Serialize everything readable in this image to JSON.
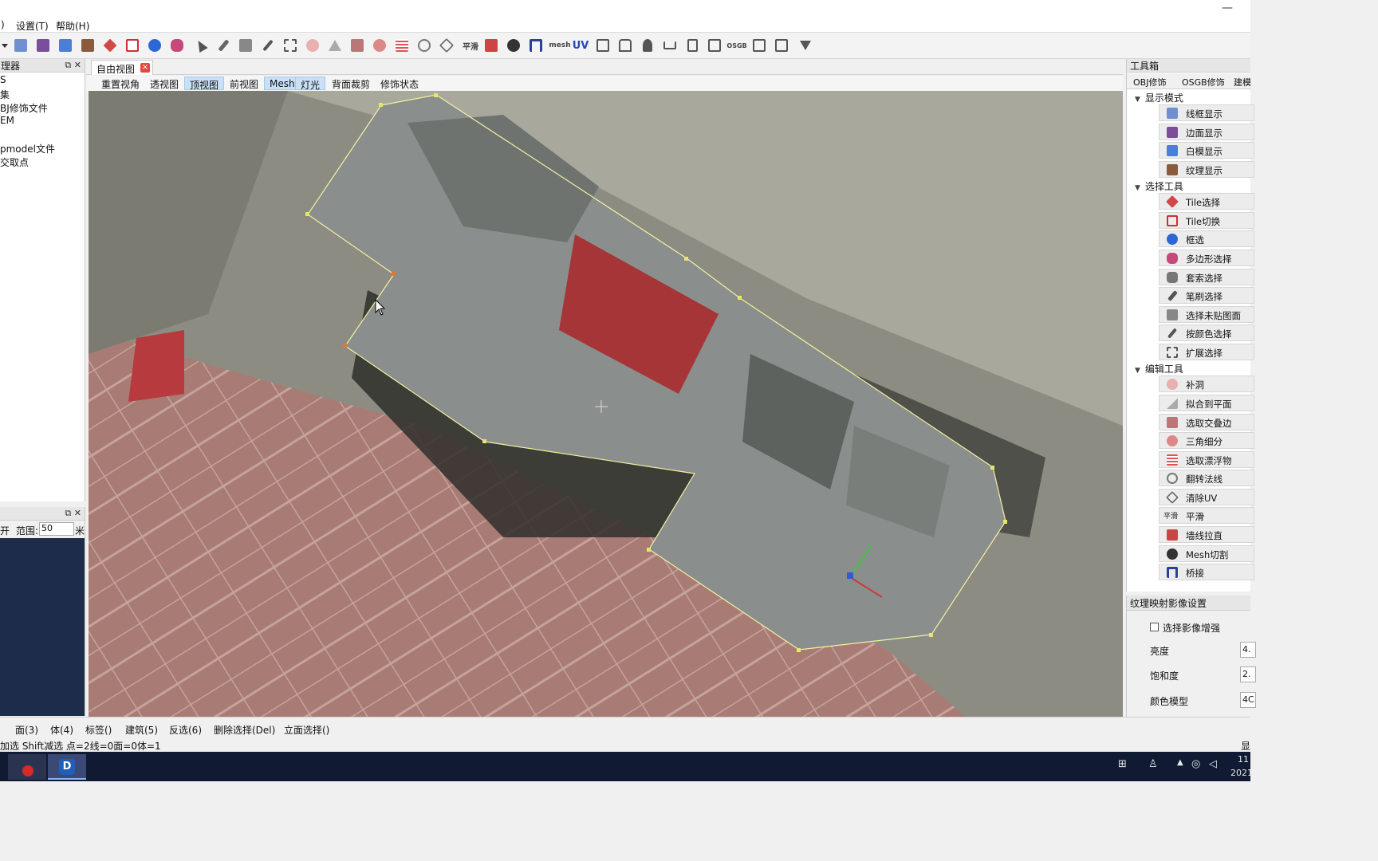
{
  "menu": {
    "item_close_paren": ")",
    "settings": "设置(T)",
    "help": "帮助(H)"
  },
  "toolbar": {
    "smooth_label": "平滑",
    "mesh_label": "mesh",
    "uv_label": "UV",
    "osgb_label": "OSGB"
  },
  "left_panel": {
    "title": "理器",
    "tree": [
      "S",
      "集",
      "BJ修饰文件",
      "EM",
      "",
      "pmodel文件",
      "交取点"
    ]
  },
  "left_panel2": {
    "open_label": "开",
    "range_label": "范围:",
    "range_value": "50",
    "unit": "米"
  },
  "view": {
    "tab_title": "自由视图",
    "buttons": [
      "重置视角",
      "透视图",
      "顶视图",
      "前视图",
      "Mesh",
      "灯光",
      "背面裁剪",
      "修饰状态"
    ],
    "active": [
      "顶视图",
      "Mesh",
      "灯光"
    ]
  },
  "toolbox": {
    "title": "工具箱",
    "tabs": [
      "OBJ修饰",
      "OSGB修饰",
      "建模"
    ],
    "sections": [
      {
        "name": "显示模式",
        "items": [
          "线框显示",
          "边面显示",
          "白模显示",
          "纹理显示"
        ]
      },
      {
        "name": "选择工具",
        "items": [
          "Tile选择",
          "Tile切换",
          "框选",
          "多边形选择",
          "套索选择",
          "笔刷选择",
          "选择未贴图面",
          "按颜色选择",
          "扩展选择"
        ]
      },
      {
        "name": "编辑工具",
        "items": [
          "补洞",
          "拟合到平面",
          "选取交叠边",
          "三角细分",
          "选取漂浮物",
          "翻转法线",
          "清除UV",
          "平滑",
          "墙线拉直",
          "Mesh切割",
          "桥接"
        ]
      }
    ]
  },
  "texture_settings": {
    "title": "纹理映射影像设置",
    "enhance_label": "选择影像增强",
    "brightness_label": "亮度",
    "brightness_value": "4.",
    "saturation_label": "饱和度",
    "saturation_value": "2.",
    "color_model_label": "颜色模型",
    "color_model_value": "4C"
  },
  "bottom": {
    "buttons": [
      "面(3)",
      "体(4)",
      "标签()",
      "建筑(5)",
      "反选(6)",
      "删除选择(Del)",
      "立面选择()"
    ],
    "status": "加选 Shift减选 点=2线=0面=0体=1",
    "right_text": "显"
  },
  "taskbar": {
    "time": "11",
    "date": "2021"
  },
  "colors": {
    "accent": "#c9e0f7",
    "selection_line": "#f2f2a0",
    "vertex": "#e6e66a",
    "taskbar": "#101a33"
  }
}
